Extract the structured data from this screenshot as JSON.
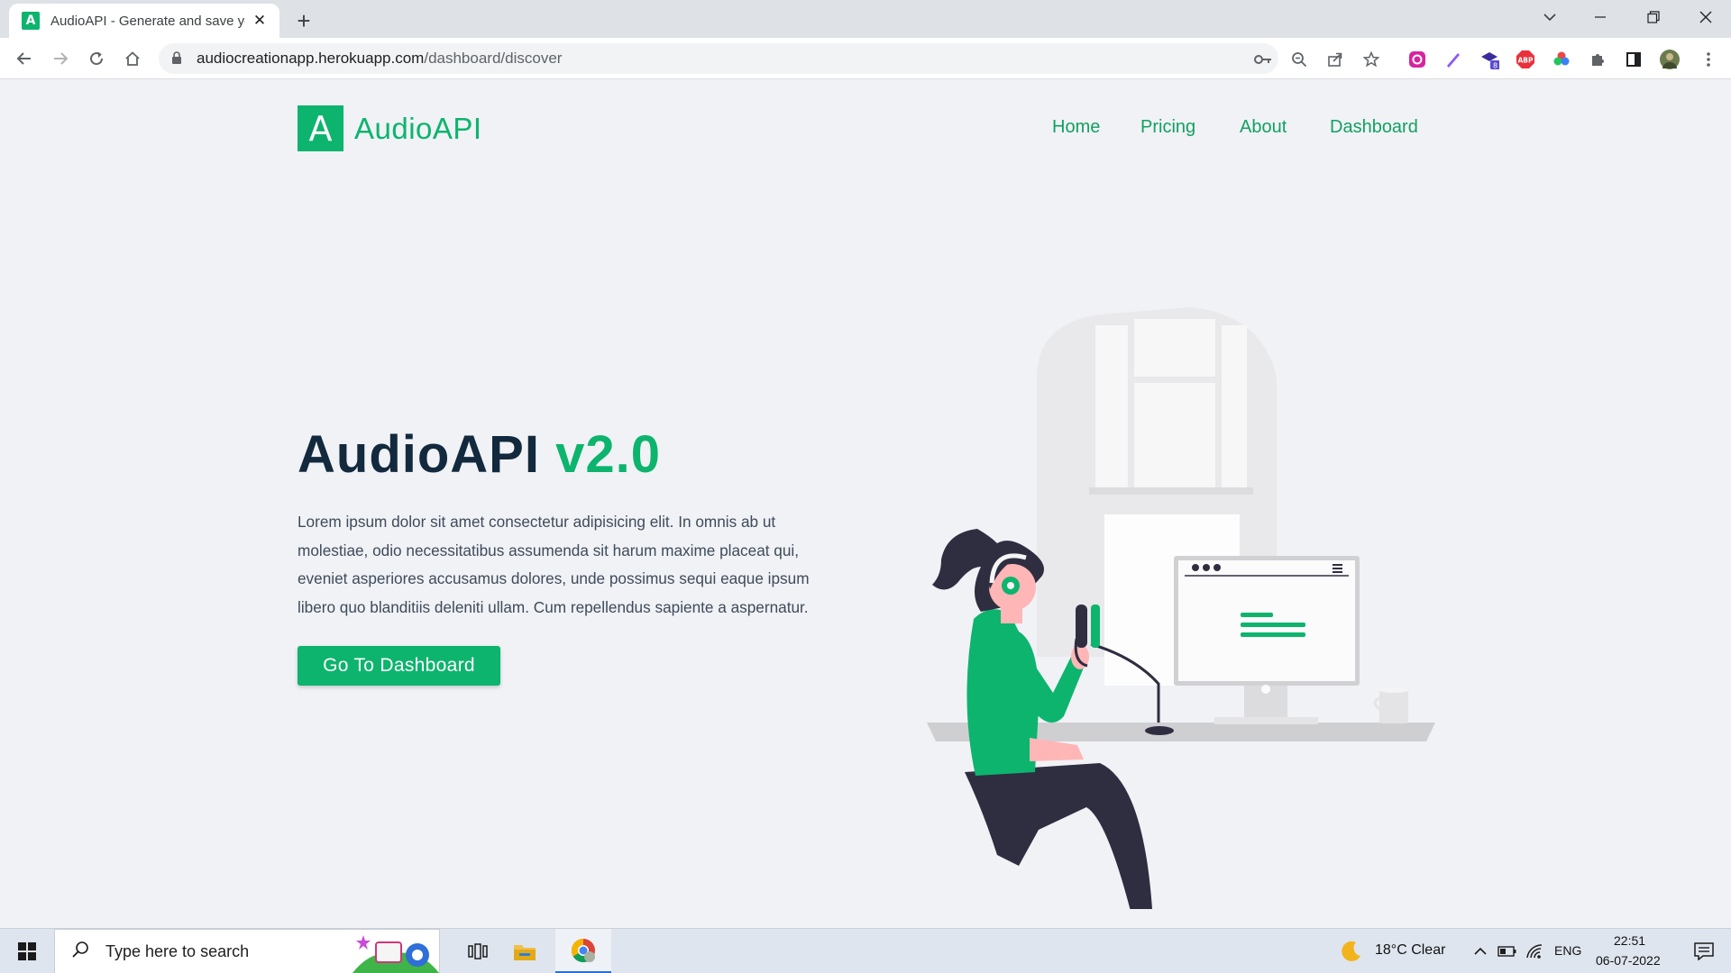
{
  "browser": {
    "tab_title": "AudioAPI - Generate and save yo",
    "favicon_letter": "A",
    "url_host": "audiocreationapp.herokuapp.com",
    "url_path": "/dashboard/discover",
    "extension_badge": "8",
    "abp_label": "ABP"
  },
  "site": {
    "logo_letter": "A",
    "logo_text": "AudioAPI",
    "nav": [
      {
        "label": "Home"
      },
      {
        "label": "Pricing"
      },
      {
        "label": "About"
      },
      {
        "label": "Dashboard"
      }
    ]
  },
  "hero": {
    "title_main": "AudioAPI ",
    "title_version": "v2.0",
    "description": "Lorem ipsum dolor sit amet consectetur adipisicing elit. In omnis ab ut molestiae, odio necessitatibus assumenda sit harum maxime placeat qui, eveniet asperiores accusamus dolores, unde possimus sequi eaque ipsum libero quo blanditiis deleniti ullam. Cum repellendus sapiente a aspernatur.",
    "cta_label": "Go To Dashboard"
  },
  "taskbar": {
    "search_placeholder": "Type here to search",
    "weather": "18°C  Clear",
    "language": "ENG",
    "time": "22:51",
    "date": "06-07-2022"
  },
  "colors": {
    "brand": "#0db46d",
    "heading": "#13293d",
    "page_bg": "#f0f2f6"
  }
}
